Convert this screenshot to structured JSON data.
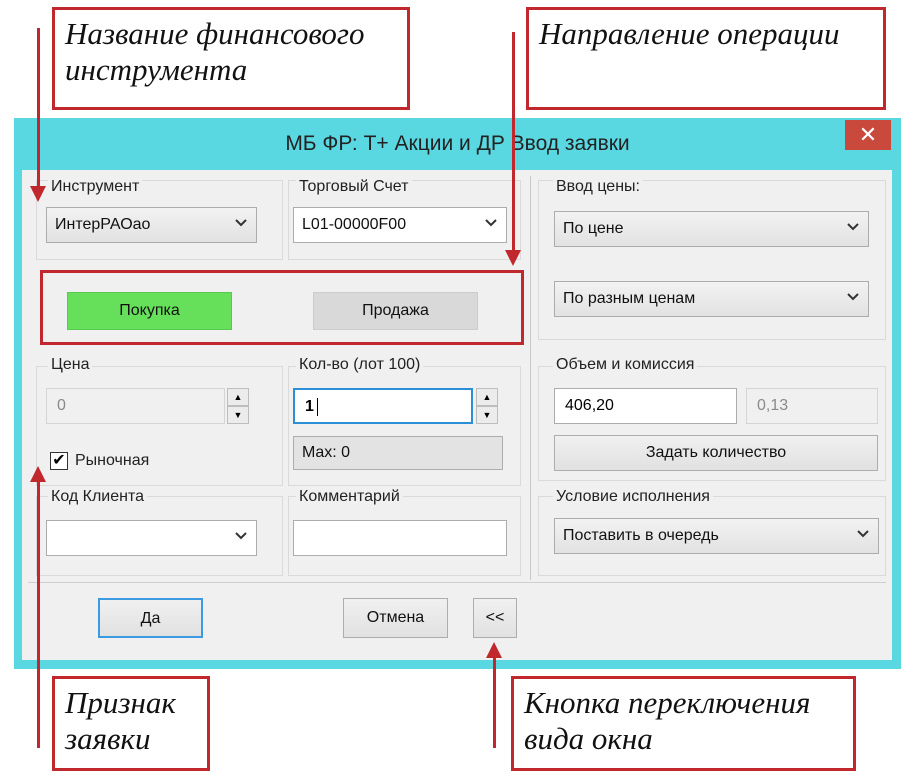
{
  "callouts": {
    "instrument_name": [
      "Название финансового",
      "инструмента"
    ],
    "direction": "Направление операции",
    "sign": [
      "Признак",
      "заявки"
    ],
    "toggle_button": [
      "Кнопка переключения",
      "вида окна"
    ]
  },
  "window": {
    "title": "МБ ФР: Т+ Акции и ДР Ввод заявки",
    "close_glyph": "✕"
  },
  "instrument": {
    "label": "Инструмент",
    "value": "ИнтерРАОао"
  },
  "account": {
    "label": "Торговый Счет",
    "value": "L01-00000F00"
  },
  "direction": {
    "buy": "Покупка",
    "sell": "Продажа",
    "buy_color": "#66e05a"
  },
  "price": {
    "label": "Цена",
    "value": "0",
    "market_label": "Рыночная",
    "market_checked": true
  },
  "quantity": {
    "label": "Кол-во (лот 100)",
    "value": "1",
    "max": "Max: 0"
  },
  "client_code": {
    "label": "Код Клиента",
    "value": ""
  },
  "comment": {
    "label": "Комментарий",
    "value": ""
  },
  "price_input": {
    "label": "Ввод цены:",
    "mode1": "По цене",
    "mode2": "По разным ценам"
  },
  "volume": {
    "label": "Объем  и комиссия",
    "amount": "406,20",
    "commission": "0,13",
    "set_qty": "Задать количество"
  },
  "execution": {
    "label": "Условие исполнения",
    "value": "Поставить в очередь"
  },
  "buttons": {
    "ok": "Да",
    "cancel": "Отмена",
    "toggle": "<<"
  },
  "colors": {
    "window_frame": "#5ad8e2",
    "callout_border": "#c0282d",
    "close": "#c94a3d"
  }
}
